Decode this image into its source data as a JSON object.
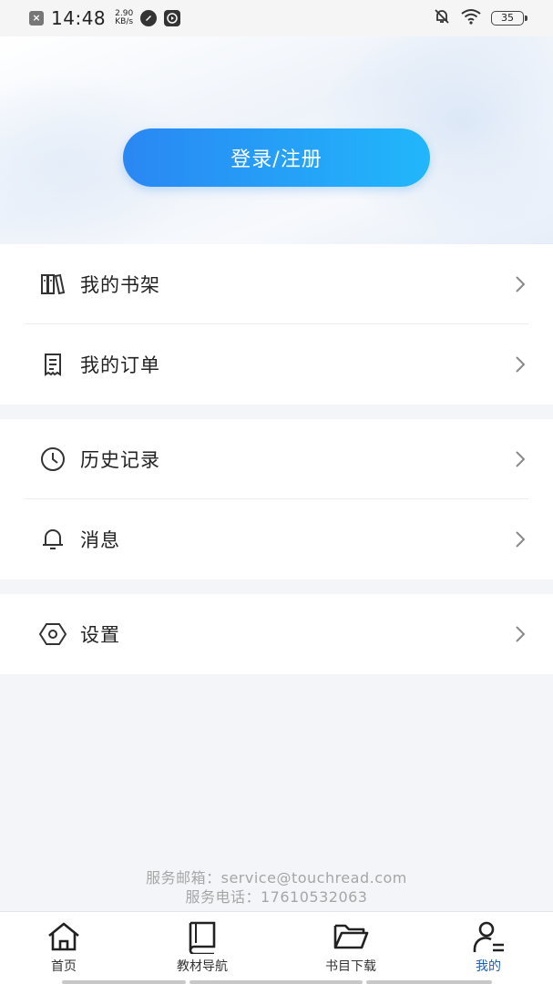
{
  "status_bar": {
    "time": "14:48",
    "speed_value": "2.90",
    "speed_unit": "KB/s",
    "battery": "35"
  },
  "header": {
    "login_label": "登录/注册"
  },
  "menu": {
    "group1": [
      {
        "label": "我的书架",
        "icon": "bookshelf-icon"
      },
      {
        "label": "我的订单",
        "icon": "order-icon"
      }
    ],
    "group2": [
      {
        "label": "历史记录",
        "icon": "clock-icon"
      },
      {
        "label": "消息",
        "icon": "bell-icon"
      }
    ],
    "group3": [
      {
        "label": "设置",
        "icon": "settings-icon"
      }
    ]
  },
  "contact": {
    "email_line": "服务邮箱：service@touchread.com",
    "phone_line": "服务电话：17610532063"
  },
  "bottom_nav": {
    "items": [
      {
        "label": "首页",
        "icon": "home-icon"
      },
      {
        "label": "教材导航",
        "icon": "book-icon"
      },
      {
        "label": "书目下载",
        "icon": "folder-icon"
      },
      {
        "label": "我的",
        "icon": "user-icon",
        "active": true
      }
    ],
    "active_color": "#1f5fb5"
  },
  "colors": {
    "login_gradient_start": "#2a87f3",
    "login_gradient_end": "#21b7fb",
    "background": "#f3f5f9"
  }
}
